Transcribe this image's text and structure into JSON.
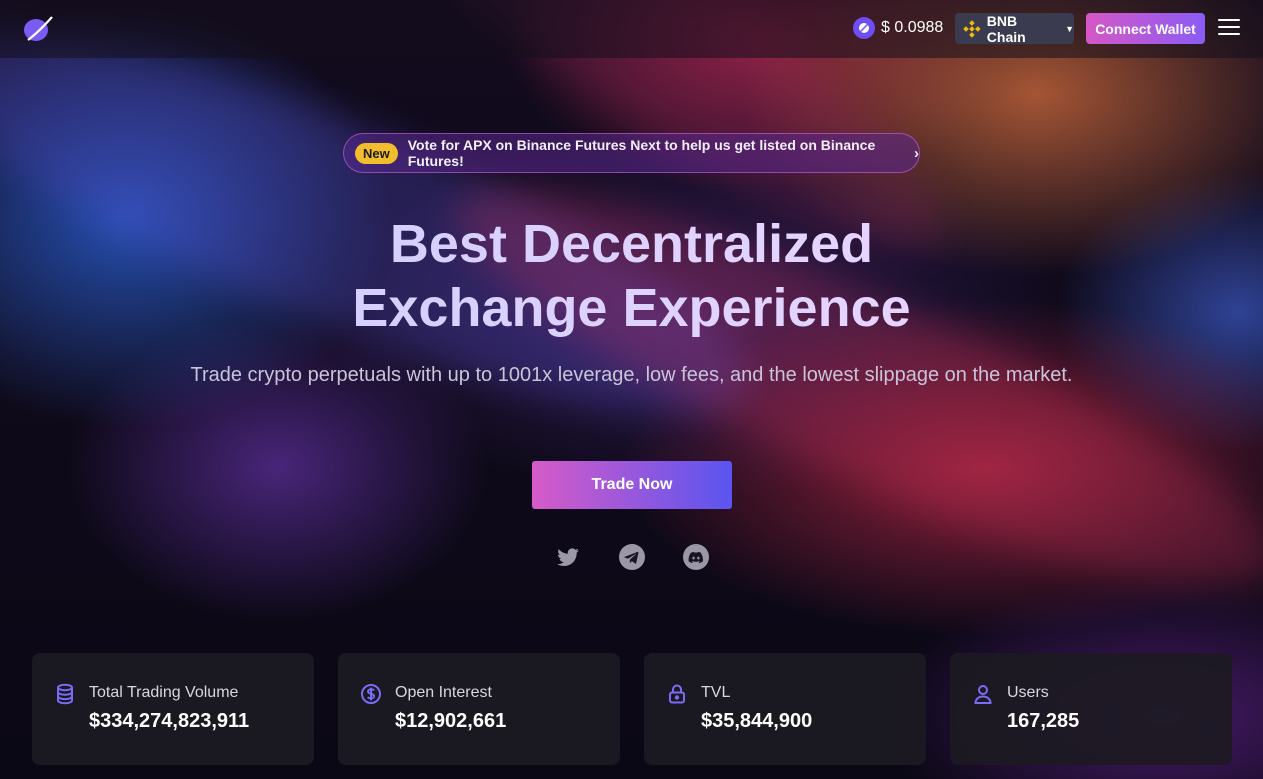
{
  "header": {
    "price": "$ 0.0988",
    "chain": "BNB Chain",
    "connect_label": "Connect Wallet"
  },
  "banner": {
    "badge": "New",
    "text": "Vote for APX on Binance Futures Next to help us get listed on Binance Futures!"
  },
  "hero": {
    "title_line1": "Best Decentralized",
    "title_line2": "Exchange Experience",
    "subtitle": "Trade crypto perpetuals with up to 1001x leverage, low fees, and the lowest slippage on the market.",
    "cta": "Trade Now"
  },
  "social": [
    "twitter-icon",
    "telegram-icon",
    "discord-icon"
  ],
  "stats": [
    {
      "label": "Total Trading Volume",
      "value": "$334,274,823,911",
      "icon": "database-icon"
    },
    {
      "label": "Open Interest",
      "value": "$12,902,661",
      "icon": "dollar-circle-icon"
    },
    {
      "label": "TVL",
      "value": "$35,844,900",
      "icon": "lock-icon"
    },
    {
      "label": "Users",
      "value": "167,285",
      "icon": "user-icon"
    }
  ],
  "colors": {
    "accent_pink": "#d657c6",
    "accent_purple": "#8a5cf5",
    "accent_blue": "#5a55f0",
    "icon_color": "#7b6cf6",
    "badge_yellow": "#f2bd2c"
  }
}
